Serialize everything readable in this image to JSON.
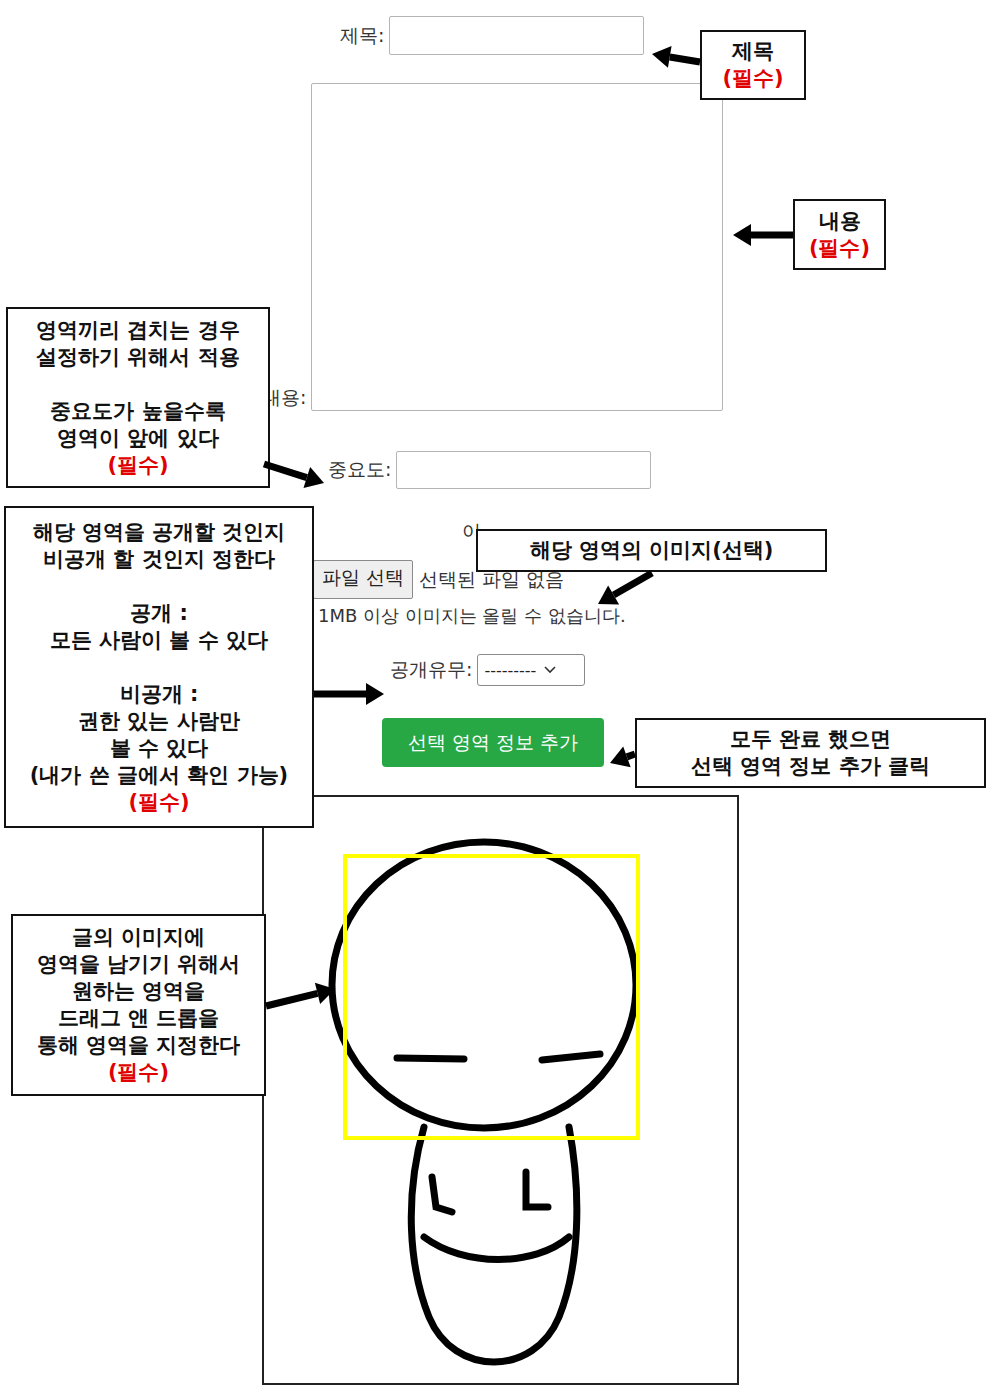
{
  "form": {
    "title_label": "제목:",
    "content_label": "내용:",
    "importance_label": "중요도:",
    "image_label_partial": "이",
    "file_button": "파일 선택",
    "file_status": "선택된 파일 없음",
    "file_note": "1MB 이상 이미지는 올릴 수 없습니다.",
    "public_label": "공개유무:",
    "public_select": "---------",
    "submit_button": "선택 영역 정보 추가"
  },
  "canvas": {
    "has_selection": true
  },
  "callouts": {
    "title": {
      "paragraphs": [
        [
          "제목"
        ]
      ],
      "required": "(필수)"
    },
    "content": {
      "paragraphs": [
        [
          "내용"
        ]
      ],
      "required": "(필수)"
    },
    "importance": {
      "paragraphs": [
        [
          "영역끼리 겹치는 경우",
          "설정하기 위해서 적용"
        ],
        [
          "중요도가 높을수록",
          "영역이 앞에 있다"
        ]
      ],
      "required": "(필수)"
    },
    "image": {
      "paragraphs": [
        [
          "해당 영역의 이미지(선택)"
        ]
      ],
      "required": ""
    },
    "public": {
      "paragraphs": [
        [
          "해당 영역을 공개할 것인지",
          "비공개 할 것인지 정한다"
        ],
        [
          "공개 :",
          "모든 사람이 볼 수 있다"
        ],
        [
          "비공개 :",
          "권한 있는 사람만",
          "볼 수 있다",
          "(내가 쓴 글에서 확인 가능)"
        ]
      ],
      "required": "(필수)"
    },
    "complete": {
      "paragraphs": [
        [
          "모두 완료 했으면",
          "선택 영역 정보 추가 클릭"
        ]
      ],
      "required": ""
    },
    "drag": {
      "paragraphs": [
        [
          "글의 이미지에",
          "영역을 남기기 위해서",
          "원하는 영역을",
          "드래그 앤 드롭을",
          "통해 영역을 지정한다"
        ]
      ],
      "required": "(필수)"
    }
  }
}
